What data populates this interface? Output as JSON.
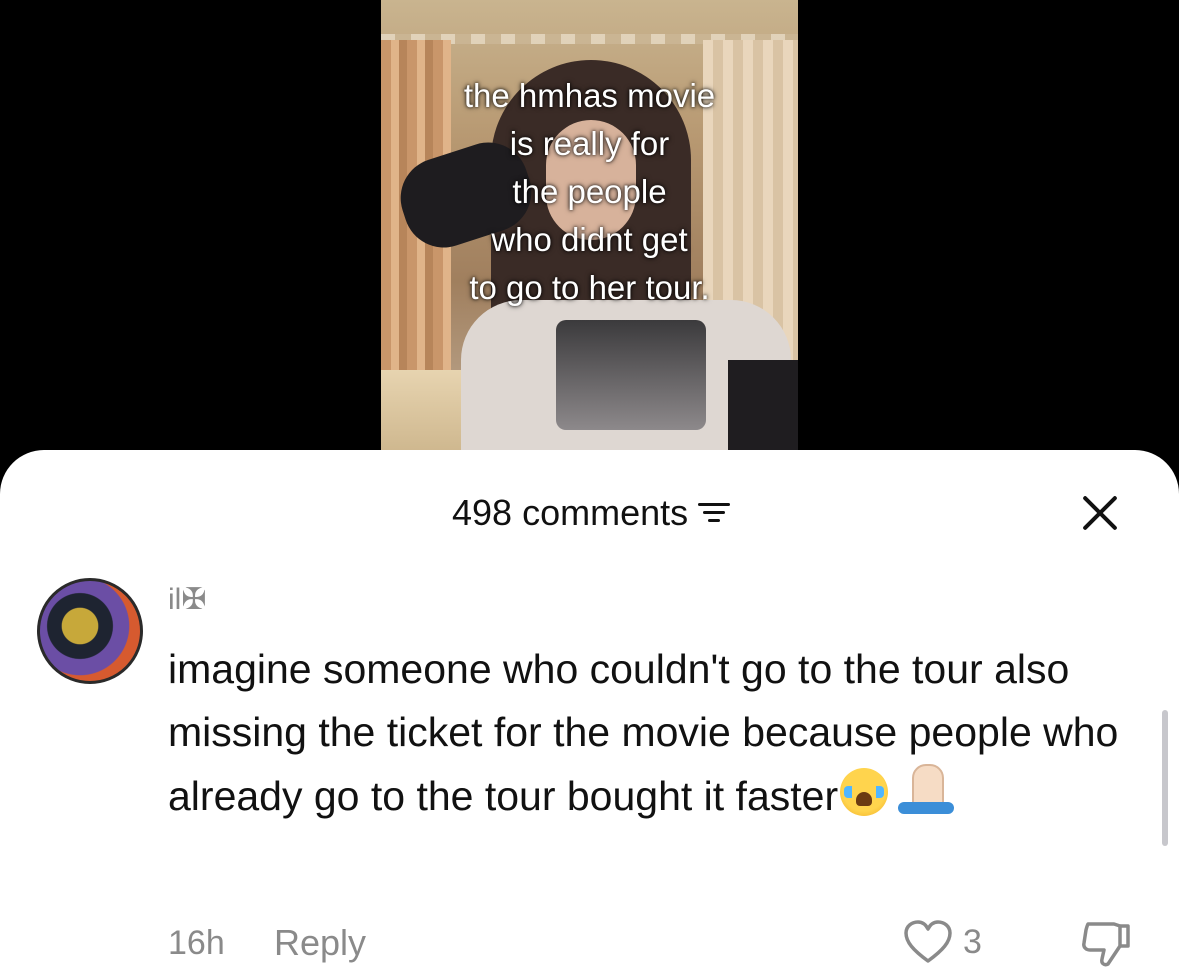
{
  "video": {
    "caption": "the hmhas movie\nis really for\nthe people\nwho didnt get\nto go to her tour."
  },
  "comments_sheet": {
    "count_label": "498 comments",
    "icons": {
      "filter": "filter-icon",
      "close": "close-icon"
    }
  },
  "comment": {
    "username": "il✠",
    "text": "imagine someone who couldn't go to the tour also missing the ticket for the movie because people who already go to the tour bought it faster",
    "emojis": [
      "😭",
      "🙏"
    ],
    "timestamp": "16h",
    "reply_label": "Reply",
    "like_count": "3",
    "icons": {
      "like": "heart-icon",
      "dislike": "thumbs-down-icon"
    }
  }
}
